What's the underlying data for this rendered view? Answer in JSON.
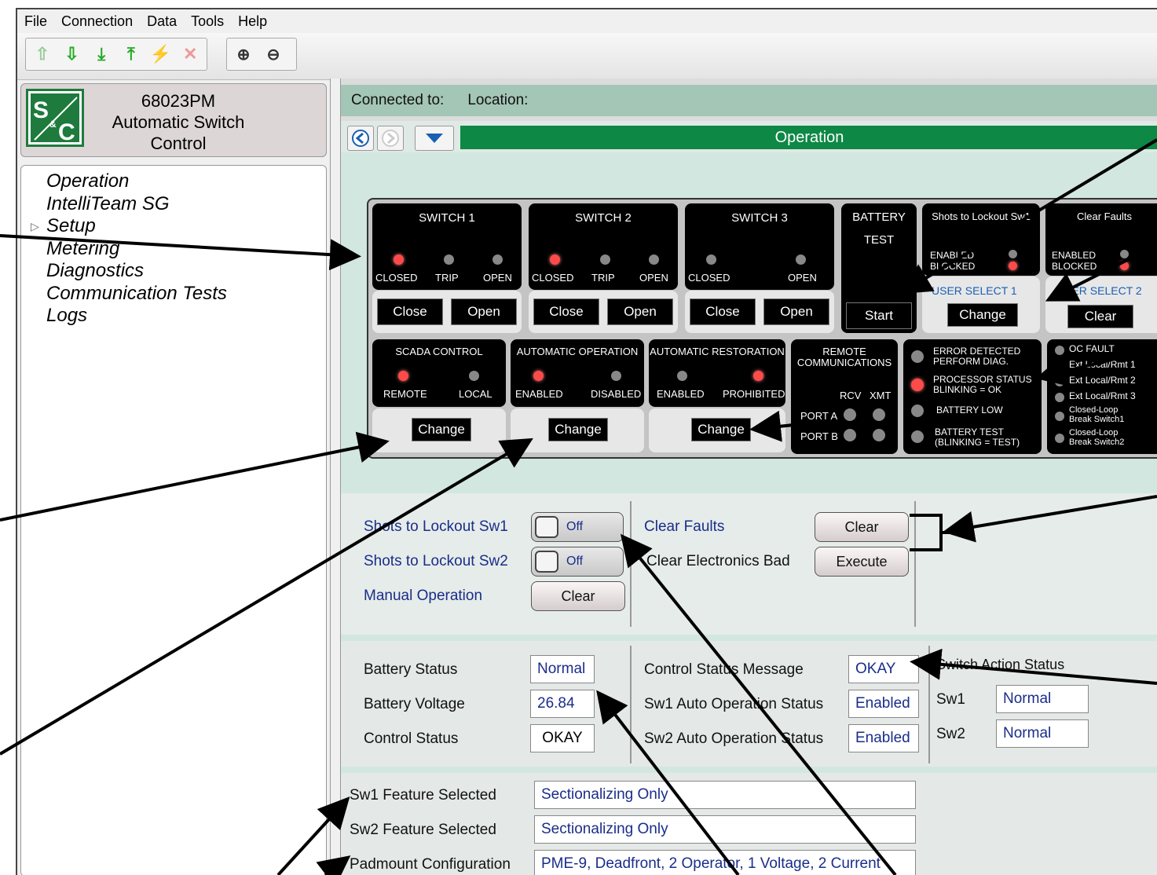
{
  "menu": [
    "File",
    "Connection",
    "Data",
    "Tools",
    "Help"
  ],
  "brand": {
    "line1": "68023PM",
    "line2": "Automatic Switch",
    "line3": "Control",
    "logo_text": "S&C"
  },
  "nav": {
    "items": [
      "Operation",
      "IntelliTeam SG",
      "Setup",
      "Metering",
      "Diagnostics",
      "Communication Tests",
      "Logs"
    ]
  },
  "conn": {
    "connected_label": "Connected to:",
    "location_label": "Location:"
  },
  "header": {
    "title": "Operation"
  },
  "panel": {
    "switch1": {
      "title": "SWITCH 1",
      "closed": "CLOSED",
      "trip": "TRIP",
      "open": "OPEN",
      "close_btn": "Close",
      "open_btn": "Open"
    },
    "switch2": {
      "title": "SWITCH 2",
      "closed": "CLOSED",
      "trip": "TRIP",
      "open": "OPEN",
      "close_btn": "Close",
      "open_btn": "Open"
    },
    "switch3": {
      "title": "SWITCH 3",
      "closed": "CLOSED",
      "open": "OPEN",
      "close_btn": "Close",
      "open_btn": "Open"
    },
    "battery": {
      "title1": "BATTERY",
      "title2": "TEST",
      "start_btn": "Start"
    },
    "shots": {
      "title": "Shots to Lockout Sw1",
      "enabled": "ENABLED",
      "blocked": "BLOCKED",
      "user_select": "USER SELECT 1",
      "change_btn": "Change"
    },
    "clearfaults": {
      "title": "Clear Faults",
      "enabled": "ENABLED",
      "blocked": "BLOCKED",
      "user_select": "USER SELECT 2",
      "clear_btn": "Clear"
    },
    "scada": {
      "title": "SCADA CONTROL",
      "remote": "REMOTE",
      "local": "LOCAL",
      "change_btn": "Change"
    },
    "autoop": {
      "title": "AUTOMATIC OPERATION",
      "enabled": "ENABLED",
      "disabled": "DISABLED",
      "change_btn": "Change"
    },
    "autorest": {
      "title": "AUTOMATIC RESTORATION",
      "enabled": "ENABLED",
      "prohibited": "PROHIBITED",
      "change_btn": "Change"
    },
    "remotecomm": {
      "title1": "REMOTE",
      "title2": "COMMUNICATIONS",
      "rcv": "RCV",
      "xmt": "XMT",
      "porta": "PORT A",
      "portb": "PORT B"
    },
    "status": {
      "err1": "ERROR DETECTED",
      "err2": "PERFORM DIAG.",
      "proc1": "PROCESSOR STATUS",
      "proc2": "BLINKING = OK",
      "batlow": "BATTERY LOW",
      "battest1": "BATTERY TEST",
      "battest2": "(BLINKING = TEST)"
    },
    "faults": {
      "oc": "OC FAULT",
      "ext1": "Ext Local/Rmt 1",
      "ext2": "Ext Local/Rmt 2",
      "ext3": "Ext Local/Rmt 3",
      "cl1a": "Closed-Loop",
      "cl1b": "Break Switch1",
      "cl2a": "Closed-Loop",
      "cl2b": "Break Switch2"
    }
  },
  "controls": {
    "shots_sw1_label": "Shots to Lockout Sw1",
    "shots_sw1_value": "Off",
    "shots_sw2_label": "Shots to Lockout Sw2",
    "shots_sw2_value": "Off",
    "manual_label": "Manual Operation",
    "manual_btn": "Clear",
    "clear_faults_label": "Clear Faults",
    "clear_faults_btn": "Clear",
    "clear_elec_label": "Clear Electronics Bad",
    "clear_elec_btn": "Execute"
  },
  "statuses": {
    "battery_status_label": "Battery Status",
    "battery_status_value": "Normal",
    "battery_voltage_label": "Battery Voltage",
    "battery_voltage_value": "26.84",
    "control_status_label": "Control Status",
    "control_status_value": "OKAY",
    "control_msg_label": "Control Status Message",
    "control_msg_value": "OKAY",
    "sw1_auto_label": "Sw1 Auto Operation Status",
    "sw1_auto_value": "Enabled",
    "sw2_auto_label": "Sw2 Auto Operation Status",
    "sw2_auto_value": "Enabled",
    "switch_action_title": "Switch Action Status",
    "sw1_label": "Sw1",
    "sw1_value": "Normal",
    "sw2_label": "Sw2",
    "sw2_value": "Normal"
  },
  "features": {
    "sw1_label": "Sw1 Feature Selected",
    "sw1_value": "Sectionalizing Only",
    "sw2_label": "Sw2 Feature Selected",
    "sw2_value": "Sectionalizing Only",
    "pad_label": "Padmount Configuration",
    "pad_value": "PME-9, Deadfront, 2 Operator, 1 Voltage, 2 Current"
  },
  "colors": {
    "accent_green": "#0d8845",
    "conn_bar": "#a3c6b6",
    "led_red": "#ff4a4a",
    "value_blue": "#1a2d8a"
  }
}
